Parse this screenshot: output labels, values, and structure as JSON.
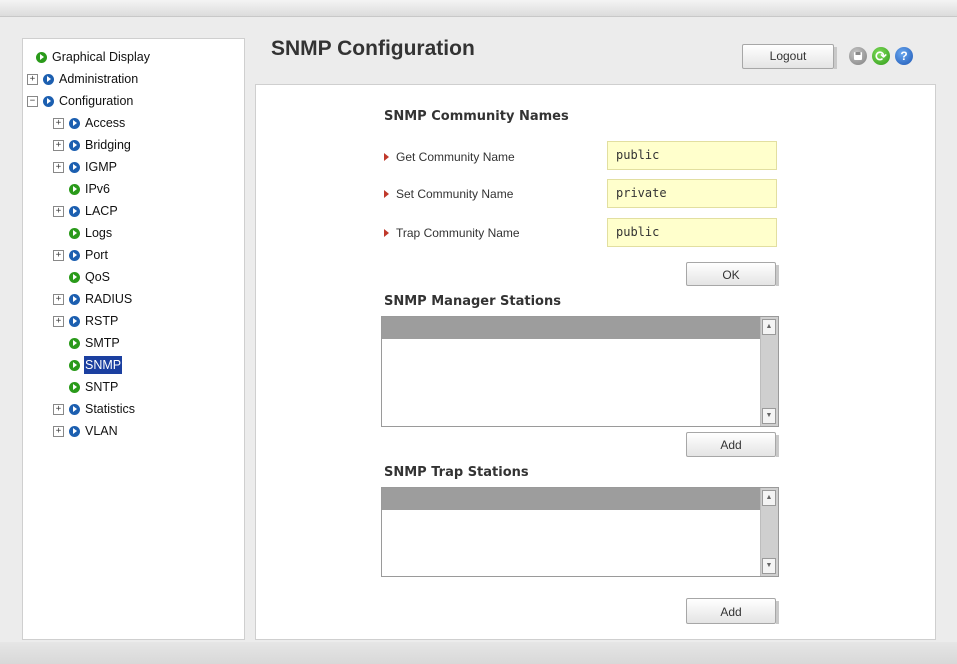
{
  "sidebar": {
    "items": [
      {
        "label": "Graphical Display",
        "expander": "",
        "color": "green"
      },
      {
        "label": "Administration",
        "expander": "+",
        "color": "blue"
      },
      {
        "label": "Configuration",
        "expander": "−",
        "color": "blue"
      },
      {
        "label": "Access",
        "expander": "+",
        "color": "blue"
      },
      {
        "label": "Bridging",
        "expander": "+",
        "color": "blue"
      },
      {
        "label": "IGMP",
        "expander": "+",
        "color": "blue"
      },
      {
        "label": "IPv6",
        "expander": "",
        "color": "green"
      },
      {
        "label": "LACP",
        "expander": "+",
        "color": "blue"
      },
      {
        "label": "Logs",
        "expander": "",
        "color": "green"
      },
      {
        "label": "Port",
        "expander": "+",
        "color": "blue"
      },
      {
        "label": "QoS",
        "expander": "",
        "color": "green"
      },
      {
        "label": "RADIUS",
        "expander": "+",
        "color": "blue"
      },
      {
        "label": "RSTP",
        "expander": "+",
        "color": "blue"
      },
      {
        "label": "SMTP",
        "expander": "",
        "color": "green"
      },
      {
        "label": "SNMP",
        "expander": "",
        "color": "green",
        "selected": true
      },
      {
        "label": "SNTP",
        "expander": "",
        "color": "green"
      },
      {
        "label": "Statistics",
        "expander": "+",
        "color": "blue"
      },
      {
        "label": "VLAN",
        "expander": "+",
        "color": "blue"
      }
    ]
  },
  "header": {
    "title": "SNMP Configuration",
    "logout_label": "Logout",
    "icons": [
      "save-icon",
      "refresh-icon",
      "help-icon"
    ],
    "refresh_glyph": "⟳",
    "help_glyph": "?"
  },
  "community": {
    "title": "SNMP Community Names",
    "fields": [
      {
        "label": "Get Community Name",
        "value": "public"
      },
      {
        "label": "Set Community Name",
        "value": "private"
      },
      {
        "label": "Trap Community Name",
        "value": "public"
      }
    ],
    "ok_label": "OK"
  },
  "managers": {
    "title": "SNMP Manager Stations",
    "add_label": "Add"
  },
  "traps": {
    "title": "SNMP Trap Stations",
    "add_label": "Add"
  },
  "scroll": {
    "up_glyph": "▲",
    "down_glyph": "▼"
  },
  "colors": {
    "selected": "#1b3fa0",
    "input_bg": "#ffffcc",
    "green_bullet": "#2a9a1a",
    "blue_bullet": "#1c5fb0",
    "arrow": "#c0392b"
  }
}
